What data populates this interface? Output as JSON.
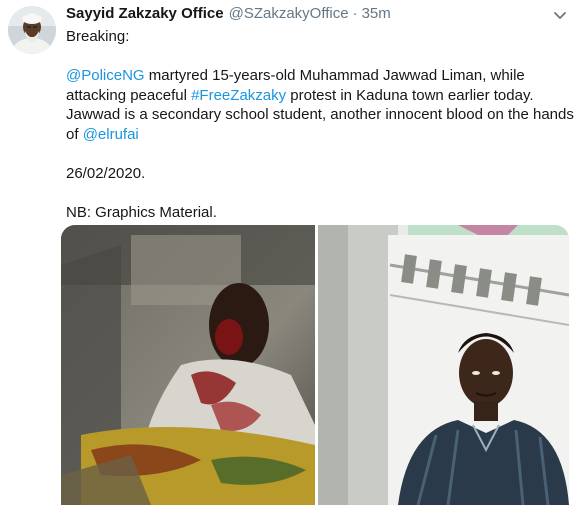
{
  "tweet": {
    "author_name": "Sayyid Zakzaky Office",
    "author_handle": "@SZakzakyOffice",
    "separator": "·",
    "time": "35m",
    "body": {
      "line1": "Breaking:",
      "mention_police": "@PoliceNG",
      "line3_rest": " martyred 15-years-old Muhammad Jawwad Liman, while",
      "line4_start": "attacking peaceful ",
      "hashtag": "#FreeZakzaky",
      "line4_rest": " protest in Kaduna town earlier today.",
      "line5": "Jawwad is a secondary school student, another innocent blood on the hands",
      "line6_start": "of ",
      "mention_elrufai": "@elrufai",
      "date": "26/02/2020.",
      "note": "NB: Graphics Material."
    }
  },
  "colors": {
    "link": "#1b95e0",
    "text": "#14171a",
    "secondary": "#657786",
    "background": "#ffffff"
  },
  "icons": {
    "caret": "chevron-down-icon"
  }
}
